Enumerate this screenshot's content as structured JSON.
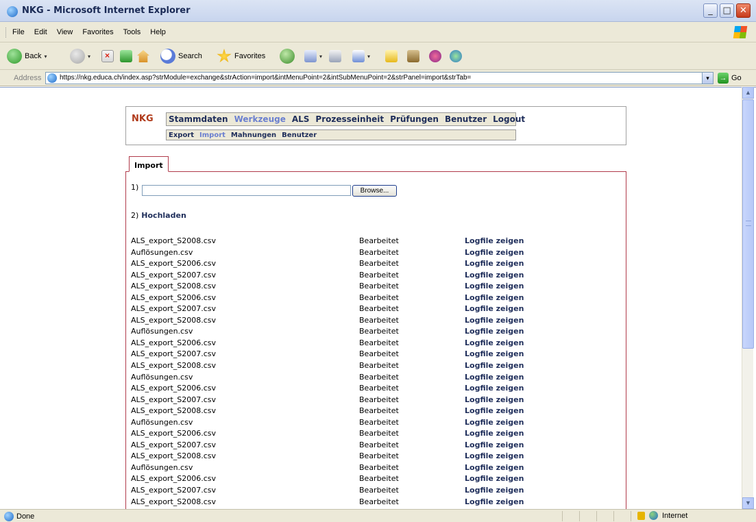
{
  "window": {
    "title": "NKG - Microsoft Internet Explorer",
    "buttons": {
      "minimize": "_",
      "maximize": "□",
      "close": "✕"
    }
  },
  "menu": [
    "File",
    "Edit",
    "View",
    "Favorites",
    "Tools",
    "Help"
  ],
  "toolbar": {
    "back": "Back",
    "search": "Search",
    "favorites": "Favorites"
  },
  "address": {
    "label": "Address",
    "url": "https://nkg.educa.ch/index.asp?strModule=exchange&strAction=import&intMenuPoint=2&intSubMenuPoint=2&strPanel=import&strTab=",
    "go": "Go"
  },
  "status": {
    "text": "Done",
    "zone": "Internet"
  },
  "app": {
    "brand": "NKG",
    "main_nav": [
      {
        "label": "Stammdaten",
        "active": false
      },
      {
        "label": "Werkzeuge",
        "active": true
      },
      {
        "label": "ALS",
        "active": false
      },
      {
        "label": "Prozesseinheit",
        "active": false
      },
      {
        "label": "Prüfungen",
        "active": false
      },
      {
        "label": "Benutzer",
        "active": false
      },
      {
        "label": "Logout",
        "active": false
      }
    ],
    "sub_nav": [
      {
        "label": "Export",
        "active": false
      },
      {
        "label": "Import",
        "active": true
      },
      {
        "label": "Mahnungen",
        "active": false
      },
      {
        "label": "Benutzer",
        "active": false
      }
    ],
    "tab": "Import",
    "step1_label": "1)",
    "file_value": "",
    "browse": "Browse...",
    "step2_label": "2)",
    "upload": "Hochladen",
    "files": [
      {
        "name": "ALS_export_S2008.csv",
        "status": "Bearbeitet",
        "action": "Logfile zeigen"
      },
      {
        "name": "Auflösungen.csv",
        "status": "Bearbeitet",
        "action": "Logfile zeigen"
      },
      {
        "name": "ALS_export_S2006.csv",
        "status": "Bearbeitet",
        "action": "Logfile zeigen"
      },
      {
        "name": "ALS_export_S2007.csv",
        "status": "Bearbeitet",
        "action": "Logfile zeigen"
      },
      {
        "name": "ALS_export_S2008.csv",
        "status": "Bearbeitet",
        "action": "Logfile zeigen"
      },
      {
        "name": "ALS_export_S2006.csv",
        "status": "Bearbeitet",
        "action": "Logfile zeigen"
      },
      {
        "name": "ALS_export_S2007.csv",
        "status": "Bearbeitet",
        "action": "Logfile zeigen"
      },
      {
        "name": "ALS_export_S2008.csv",
        "status": "Bearbeitet",
        "action": "Logfile zeigen"
      },
      {
        "name": "Auflösungen.csv",
        "status": "Bearbeitet",
        "action": "Logfile zeigen"
      },
      {
        "name": "ALS_export_S2006.csv",
        "status": "Bearbeitet",
        "action": "Logfile zeigen"
      },
      {
        "name": "ALS_export_S2007.csv",
        "status": "Bearbeitet",
        "action": "Logfile zeigen"
      },
      {
        "name": "ALS_export_S2008.csv",
        "status": "Bearbeitet",
        "action": "Logfile zeigen"
      },
      {
        "name": "Auflösungen.csv",
        "status": "Bearbeitet",
        "action": "Logfile zeigen"
      },
      {
        "name": "ALS_export_S2006.csv",
        "status": "Bearbeitet",
        "action": "Logfile zeigen"
      },
      {
        "name": "ALS_export_S2007.csv",
        "status": "Bearbeitet",
        "action": "Logfile zeigen"
      },
      {
        "name": "ALS_export_S2008.csv",
        "status": "Bearbeitet",
        "action": "Logfile zeigen"
      },
      {
        "name": "Auflösungen.csv",
        "status": "Bearbeitet",
        "action": "Logfile zeigen"
      },
      {
        "name": "ALS_export_S2006.csv",
        "status": "Bearbeitet",
        "action": "Logfile zeigen"
      },
      {
        "name": "ALS_export_S2007.csv",
        "status": "Bearbeitet",
        "action": "Logfile zeigen"
      },
      {
        "name": "ALS_export_S2008.csv",
        "status": "Bearbeitet",
        "action": "Logfile zeigen"
      },
      {
        "name": "Auflösungen.csv",
        "status": "Bearbeitet",
        "action": "Logfile zeigen"
      },
      {
        "name": "ALS_export_S2006.csv",
        "status": "Bearbeitet",
        "action": "Logfile zeigen"
      },
      {
        "name": "ALS_export_S2007.csv",
        "status": "Bearbeitet",
        "action": "Logfile zeigen"
      },
      {
        "name": "ALS_export_S2008.csv",
        "status": "Bearbeitet",
        "action": "Logfile zeigen"
      }
    ]
  },
  "colors": {
    "brand": "#b03a1a",
    "nav_text": "#1e2d5a",
    "nav_active": "#6a7fd0",
    "panel_border": "#b03a4a",
    "chrome": "#ece9d8"
  },
  "icons": {
    "app": "ie-icon",
    "back": "back-arrow-icon",
    "forward": "forward-arrow-icon",
    "stop": "stop-icon",
    "refresh": "refresh-icon",
    "home": "home-icon",
    "search": "search-icon",
    "favorites": "favorites-star-icon",
    "go": "go-arrow-icon",
    "lock": "lock-icon",
    "zone": "globe-icon"
  }
}
